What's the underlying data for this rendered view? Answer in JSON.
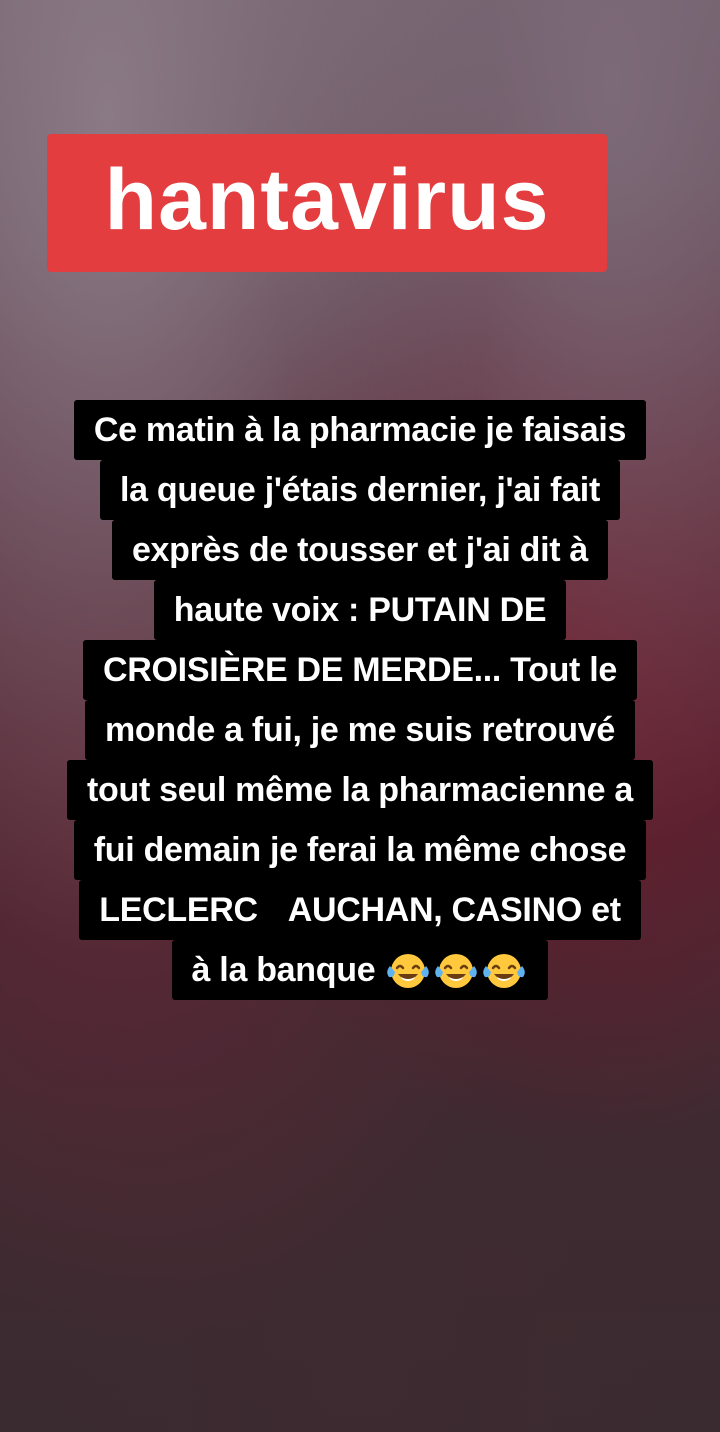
{
  "title": {
    "label": "hantavirus",
    "color": "#e43d3f"
  },
  "caption": {
    "lines": [
      "Ce matin à la pharmacie je faisais",
      "la queue j'étais dernier, j'ai fait",
      "exprès de tousser et j'ai dit à",
      "haute voix : PUTAIN DE",
      "CROISIÈRE DE MERDE... Tout le",
      "monde a fui, je me suis retrouvé",
      "tout seul même la pharmacienne a",
      "fui demain je ferai la même chose"
    ],
    "line9_a": "LECLERC",
    "line9_b": "AUCHAN, CASINO et",
    "line10": "à la banque",
    "emoji": "face-with-tears-of-joy-icon"
  }
}
